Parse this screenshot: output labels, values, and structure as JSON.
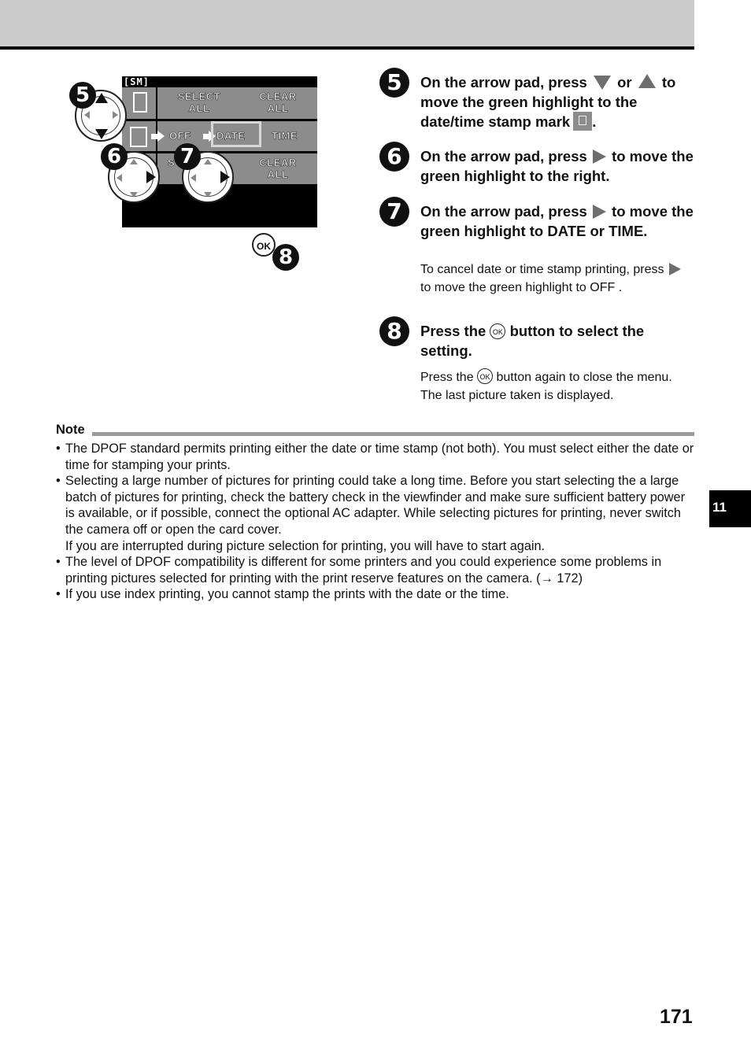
{
  "screen": {
    "title": "[SM]",
    "row1": {
      "select_all": "SELECT\nALL",
      "clear_all": "CLEAR\nALL"
    },
    "row2": {
      "off": "OFF",
      "date": "DATE",
      "time": "TIME"
    },
    "row3": {
      "partial": "S",
      "clear_all": "CLEAR\nALL"
    },
    "callouts": {
      "step5": "5",
      "step6": "6",
      "step7": "7",
      "step8": "8",
      "ok": "OK"
    }
  },
  "steps": [
    {
      "number": "5",
      "heading_parts": [
        "On the arrow pad, press",
        "or",
        "to move the green highlight to the date/time stamp mark",
        "."
      ]
    },
    {
      "number": "6",
      "heading_parts": [
        "On the arrow pad, press",
        "to move the green highlight to the right."
      ]
    },
    {
      "number": "7",
      "heading_parts": [
        "On the arrow pad, press",
        "to move the green highlight to DATE or TIME."
      ],
      "body_parts": [
        "To cancel date or time stamp printing, press",
        "to move the green highlight to OFF ."
      ]
    },
    {
      "number": "8",
      "heading_parts": [
        "Press the",
        "button to select the setting."
      ],
      "body_parts": [
        "Press the",
        "button again to close the menu. The last picture taken is displayed."
      ]
    }
  ],
  "ok_glyph": "OK",
  "note": {
    "label": "Note",
    "items": [
      "The DPOF standard permits printing either the date or time stamp (not both). You must select either the date or time for stamping your prints.",
      "Selecting a large number of pictures for printing could take a long time. Before you start selecting the a large batch of pictures for printing, check the battery check in the viewfinder and make sure sufficient battery power is available, or if possible, connect the optional AC adapter. While selecting pictures for printing, never switch the camera off or open the card cover.",
      "If you are interrupted during picture selection for printing, you will have to start again.",
      "The level of DPOF compatibility is different for some printers and you could experience some problems in printing pictures selected for printing with the print reserve features on the camera. (→ 172)",
      "If you use index printing, you cannot stamp the prints with the date or the time."
    ]
  },
  "chapter_tab": "11",
  "page_number": "171"
}
